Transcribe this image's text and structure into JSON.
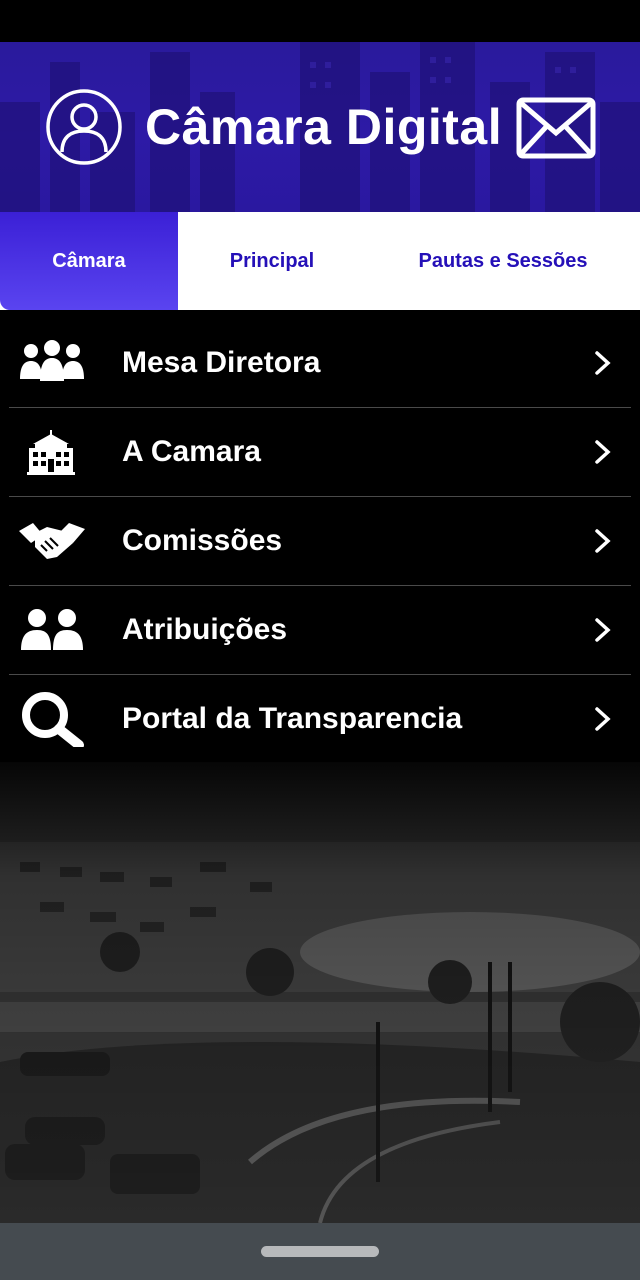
{
  "header": {
    "title": "Câmara Digital",
    "user_icon": "user-circle-icon",
    "mail_icon": "envelope-icon",
    "background_color": "#2d1aa6"
  },
  "tabs": [
    {
      "label": "Câmara",
      "active": true
    },
    {
      "label": "Principal",
      "active": false
    },
    {
      "label": "Pautas e Sessões",
      "active": false
    }
  ],
  "menu": {
    "items": [
      {
        "label": "Mesa Diretora",
        "icon": "group-people-icon"
      },
      {
        "label": "A Camara",
        "icon": "building-icon"
      },
      {
        "label": "Comissões",
        "icon": "handshake-icon"
      },
      {
        "label": "Atribuições",
        "icon": "two-people-icon"
      },
      {
        "label": "Portal da Transparencia",
        "icon": "magnifier-icon"
      }
    ],
    "chevron_icon": "chevron-right-icon"
  },
  "background_photo": "historic-plaza-photo",
  "colors": {
    "accent": "#2510b8",
    "active_tab": "#4a33e6",
    "menu_background": "#000000"
  }
}
